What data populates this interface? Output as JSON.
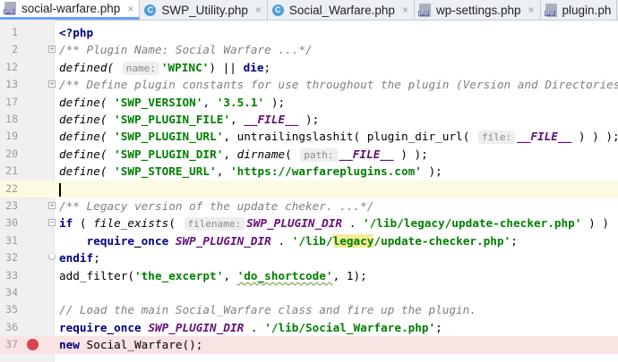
{
  "tabs": [
    {
      "label": "social-warfare.php",
      "icon": "php-file-icon",
      "active": true
    },
    {
      "label": "SWP_Utility.php",
      "icon": "class-icon",
      "active": false
    },
    {
      "label": "Social_Warfare.php",
      "icon": "class-icon",
      "active": false
    },
    {
      "label": "wp-settings.php",
      "icon": "php-file-icon",
      "active": false
    },
    {
      "label": "plugin.ph",
      "icon": "php-file-icon",
      "active": false
    }
  ],
  "close_glyph": "×",
  "class_glyph": "C",
  "colors": {
    "keyword": "#000080",
    "string": "#008000",
    "constant": "#660e7a",
    "comment": "#808080",
    "breakpoint": "#d9414f",
    "current_line": "#fcfae0"
  },
  "lines": {
    "l1": {
      "num": "1",
      "t": [
        "<?php"
      ]
    },
    "l2": {
      "num": "2",
      "t": [
        "/** Plugin Name: Social Warfare ...*/"
      ]
    },
    "l12": {
      "num": "12",
      "t": [
        "defined(",
        "name:",
        "'WPINC'",
        ") || ",
        "die",
        ";"
      ]
    },
    "l13": {
      "num": "13",
      "t": [
        "/** Define plugin constants for use throughout the plugin (Version and Directories) ."
      ]
    },
    "l17": {
      "num": "17",
      "t": [
        "define(",
        "'SWP_VERSION'",
        ", ",
        "'3.5.1'",
        " );"
      ]
    },
    "l18": {
      "num": "18",
      "t": [
        "define(",
        "'SWP_PLUGIN_FILE'",
        ", ",
        "__FILE__",
        " );"
      ]
    },
    "l19": {
      "num": "19",
      "t": [
        "define(",
        "'SWP_PLUGIN_URL'",
        ", untrailingslashit( plugin_dir_url(",
        "file:",
        "__FILE__",
        " ) ) );"
      ]
    },
    "l20": {
      "num": "20",
      "t": [
        "define(",
        "'SWP_PLUGIN_DIR'",
        ", ",
        "dirname",
        "(",
        "path:",
        "__FILE__",
        " ) );"
      ]
    },
    "l21": {
      "num": "21",
      "t": [
        "define(",
        "'SWP_STORE_URL'",
        ", ",
        "'https://warfareplugins.com'",
        " );"
      ]
    },
    "l22": {
      "num": "22"
    },
    "l23": {
      "num": "23",
      "t": [
        "/** Legacy version of the update cheker. ...*/"
      ]
    },
    "l30": {
      "num": "30",
      "t": [
        "if",
        " ( ",
        "file_exists",
        "(",
        "filename:",
        "SWP_PLUGIN_DIR",
        " . ",
        "'/lib/legacy/update-checker.php'",
        " ) ) :"
      ]
    },
    "l31": {
      "num": "31",
      "t": [
        "require_once",
        " ",
        "SWP_PLUGIN_DIR",
        " . ",
        "'/lib/",
        "legacy",
        "/update-checker.php'",
        ";"
      ]
    },
    "l32": {
      "num": "32",
      "t": [
        "endif",
        ";"
      ]
    },
    "l33": {
      "num": "33",
      "t": [
        "add_filter(",
        "'the_excerpt'",
        ", ",
        "'do_shortcode'",
        ", 1);"
      ]
    },
    "l34": {
      "num": "34"
    },
    "l35": {
      "num": "35",
      "t": [
        "// Load the main Social_Warfare class and fire up the plugin."
      ]
    },
    "l36": {
      "num": "36",
      "t": [
        "require_once",
        " ",
        "SWP_PLUGIN_DIR",
        " . ",
        "'/lib/Social_Warfare.php'",
        ";"
      ]
    },
    "l37": {
      "num": "37",
      "t": [
        "new",
        " Social_Warfare();"
      ]
    }
  }
}
